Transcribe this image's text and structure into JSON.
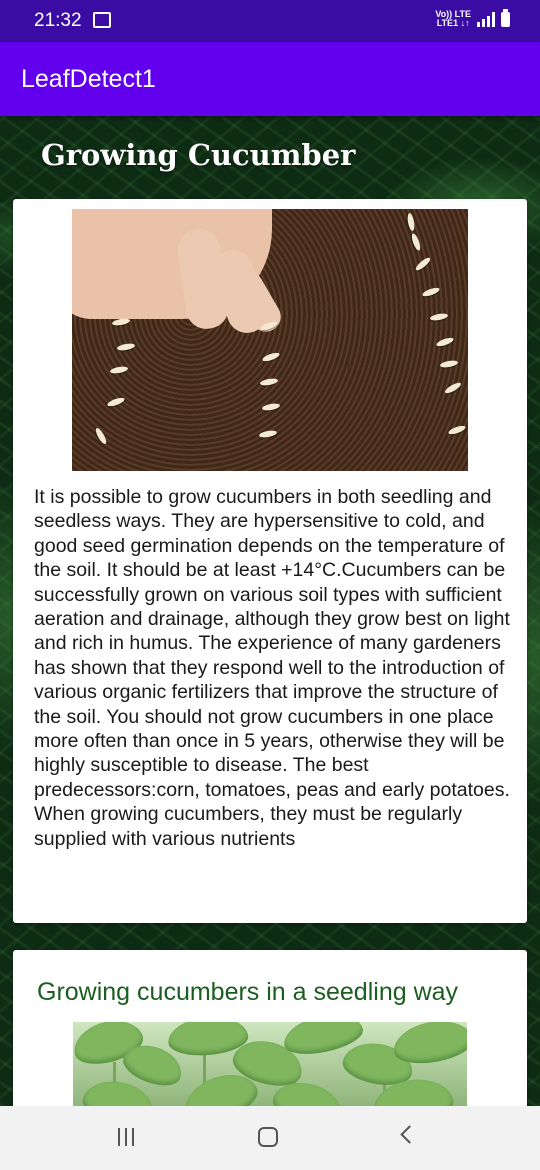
{
  "status_bar": {
    "time": "21:32",
    "network_line1": "Vo)) LTE",
    "network_line2": "LTE1 ↓↑",
    "icons": [
      "gallery-icon",
      "signal-icon",
      "battery-icon"
    ]
  },
  "app_bar": {
    "title": "LeafDetect1",
    "color": "#6200ee"
  },
  "main": {
    "heading": "Growing Cucumber",
    "card1": {
      "image_description_icon": "seeds-photo",
      "text": "It is possible to grow cucumbers in both seedling and seedless ways. They are hypersensitive to cold, and good seed germination depends on the temperature of the soil. It should be at least +14°C.Cucumbers can be successfully grown on various soil types with sufficient aeration and drainage, although they grow best on light and rich in humus. The experience of many gardeners has shown that they respond well to the introduction of various organic fertilizers that improve the structure of the soil. You should not grow cucumbers in one place more often than once in 5 years, otherwise they will be highly susceptible to disease. The best predecessors:corn, tomatoes, peas and early potatoes. When growing cucumbers, they must be regularly supplied with various nutrients"
    },
    "card2": {
      "heading": "Growing cucumbers in a seedling way",
      "heading_color": "#1b5e20"
    }
  },
  "nav_bar": {
    "buttons": [
      "recent-apps",
      "home",
      "back"
    ]
  }
}
